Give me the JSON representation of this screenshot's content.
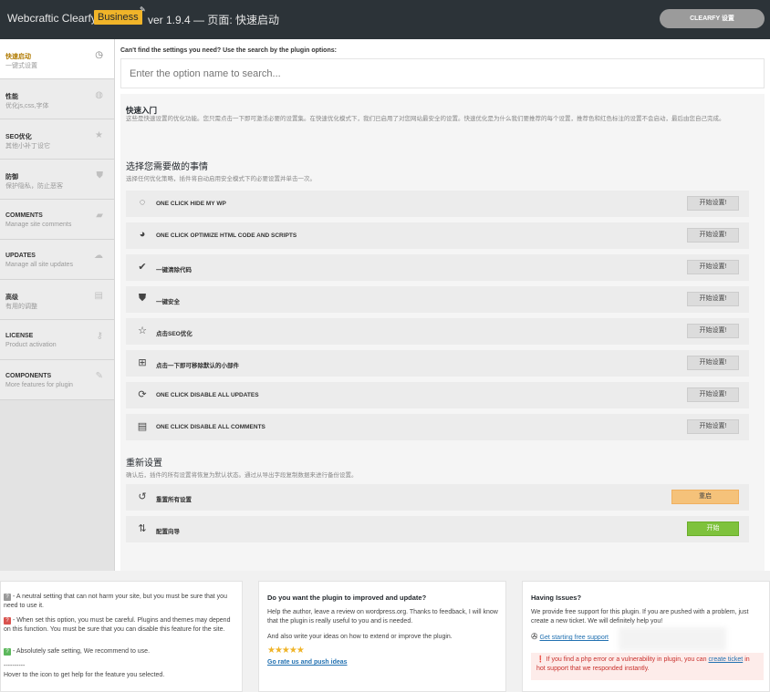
{
  "header": {
    "brand": "Webcraftic Clearfy",
    "badge": "Business",
    "version": "ver 1.9.4 — 页面: 快速启动",
    "settings_button": "CLEARFY 设置"
  },
  "sidebar": {
    "items": [
      {
        "title": "快速启动",
        "sub": "一键式设置",
        "icon": "clock-icon",
        "glyph": "◷",
        "active": true
      },
      {
        "title": "性能",
        "sub": "优化js,css,字体",
        "icon": "gauge-icon",
        "glyph": "◍"
      },
      {
        "title": "SEO优化",
        "sub": "其他小补丁设它",
        "icon": "star-icon",
        "glyph": "★"
      },
      {
        "title": "防御",
        "sub": "保护隐私，防止恶客",
        "icon": "shield-icon",
        "glyph": "⛊"
      },
      {
        "title": "COMMENTS",
        "sub": "Manage site comments",
        "icon": "comment-icon",
        "glyph": "▰"
      },
      {
        "title": "UPDATES",
        "sub": "Manage all site updates",
        "icon": "cloud-icon",
        "glyph": "☁"
      },
      {
        "title": "高级",
        "sub": "有用的调整",
        "icon": "table-icon",
        "glyph": "▤"
      },
      {
        "title": "LICENSE",
        "sub": "Product activation",
        "icon": "key-icon",
        "glyph": "⚷"
      },
      {
        "title": "COMPONENTS",
        "sub": "More features for plugin",
        "icon": "plug-icon",
        "glyph": "✎"
      }
    ]
  },
  "search": {
    "label": "Can't find the settings you need? Use the search by the plugin options:",
    "placeholder": "Enter the option name to search..."
  },
  "intro": {
    "title": "快速入门",
    "desc": "这些是快速设置的优化功能。您只需点击一下即可激活必要的设置集。在快速优化模式下，我们已启用了对您网站最安全的设置。快速优化是为什么我们要推荐的每个设置，推荐色和红色标注的设置不会启动，最后由您自己完成。"
  },
  "choose": {
    "title": "选择您需要做的事情",
    "desc": "选择任何优化策略，插件将自动启用安全模式下的必要设置并单击一次。",
    "options": [
      {
        "icon": "eye-slash-icon",
        "glyph": "◌",
        "label": "ONE CLICK HIDE MY WP",
        "button": "开始设置!"
      },
      {
        "icon": "dashboard-icon",
        "glyph": "◕",
        "label": "ONE CLICK OPTIMIZE HTML CODE AND SCRIPTS",
        "button": "开始设置!"
      },
      {
        "icon": "check-icon",
        "glyph": "✔",
        "label": "一键清除代码",
        "button": "开始设置!"
      },
      {
        "icon": "shield-icon",
        "glyph": "⛊",
        "label": "一键安全",
        "button": "开始设置!"
      },
      {
        "icon": "star-outline-icon",
        "glyph": "☆",
        "label": "点击SEO优化",
        "button": "开始设置!"
      },
      {
        "icon": "sitemap-icon",
        "glyph": "⊞",
        "label": "点击一下即可移除默认的小部件",
        "button": "开始设置!"
      },
      {
        "icon": "refresh-icon",
        "glyph": "⟳",
        "label": "ONE CLICK DISABLE ALL UPDATES",
        "button": "开始设置!"
      },
      {
        "icon": "comment-icon",
        "glyph": "▤",
        "label": "ONE CLICK DISABLE ALL COMMENTS",
        "button": "开始设置!"
      }
    ]
  },
  "reset": {
    "title": "重新设置",
    "desc": "确认后，插件的所有设置将恢复为默认状态。通过从导出字段复制数据来进行备份设置。",
    "options": [
      {
        "icon": "history-icon",
        "glyph": "↺",
        "label": "重置所有设置",
        "button": "重启",
        "style": "orange"
      },
      {
        "icon": "sort-icon",
        "glyph": "⇅",
        "label": "配置向导",
        "button": "开始",
        "style": "green"
      }
    ]
  },
  "footer": {
    "legend": {
      "grey_badge": "?",
      "grey_text": "- A neutral setting that can not harm your site, but you must be sure that you need to use it.",
      "red_badge": "?",
      "red_text": "- When set this option, you must be careful. Plugins and themes may depend on this function. You must be sure that you can disable this feature for the site.",
      "green_badge": "?",
      "green_text": "- Absolutely safe setting, We recommend to use.",
      "dashes": "----------",
      "hover": "Hover to the icon to get help for the feature you selected."
    },
    "review": {
      "title": "Do you want the plugin to improved and update?",
      "text1": "Help the author, leave a review on wordpress.org. Thanks to feedback, I will know that the plugin is really useful to you and is needed.",
      "text2": "And also write your ideas on how to extend or improve the plugin.",
      "stars": "★★★★★",
      "link": "Go rate us and push ideas"
    },
    "issues": {
      "title": "Having Issues?",
      "text": "We provide free support for this plugin. If you are pushed with a problem, just create a new ticket. We will definitely help you!",
      "support_link": "Get starting free support",
      "alert_pre": "If you find a php error or a vulnerability in plugin, you can ",
      "alert_link": "create ticket",
      "alert_post": " in hot support that we responded instantly."
    }
  }
}
